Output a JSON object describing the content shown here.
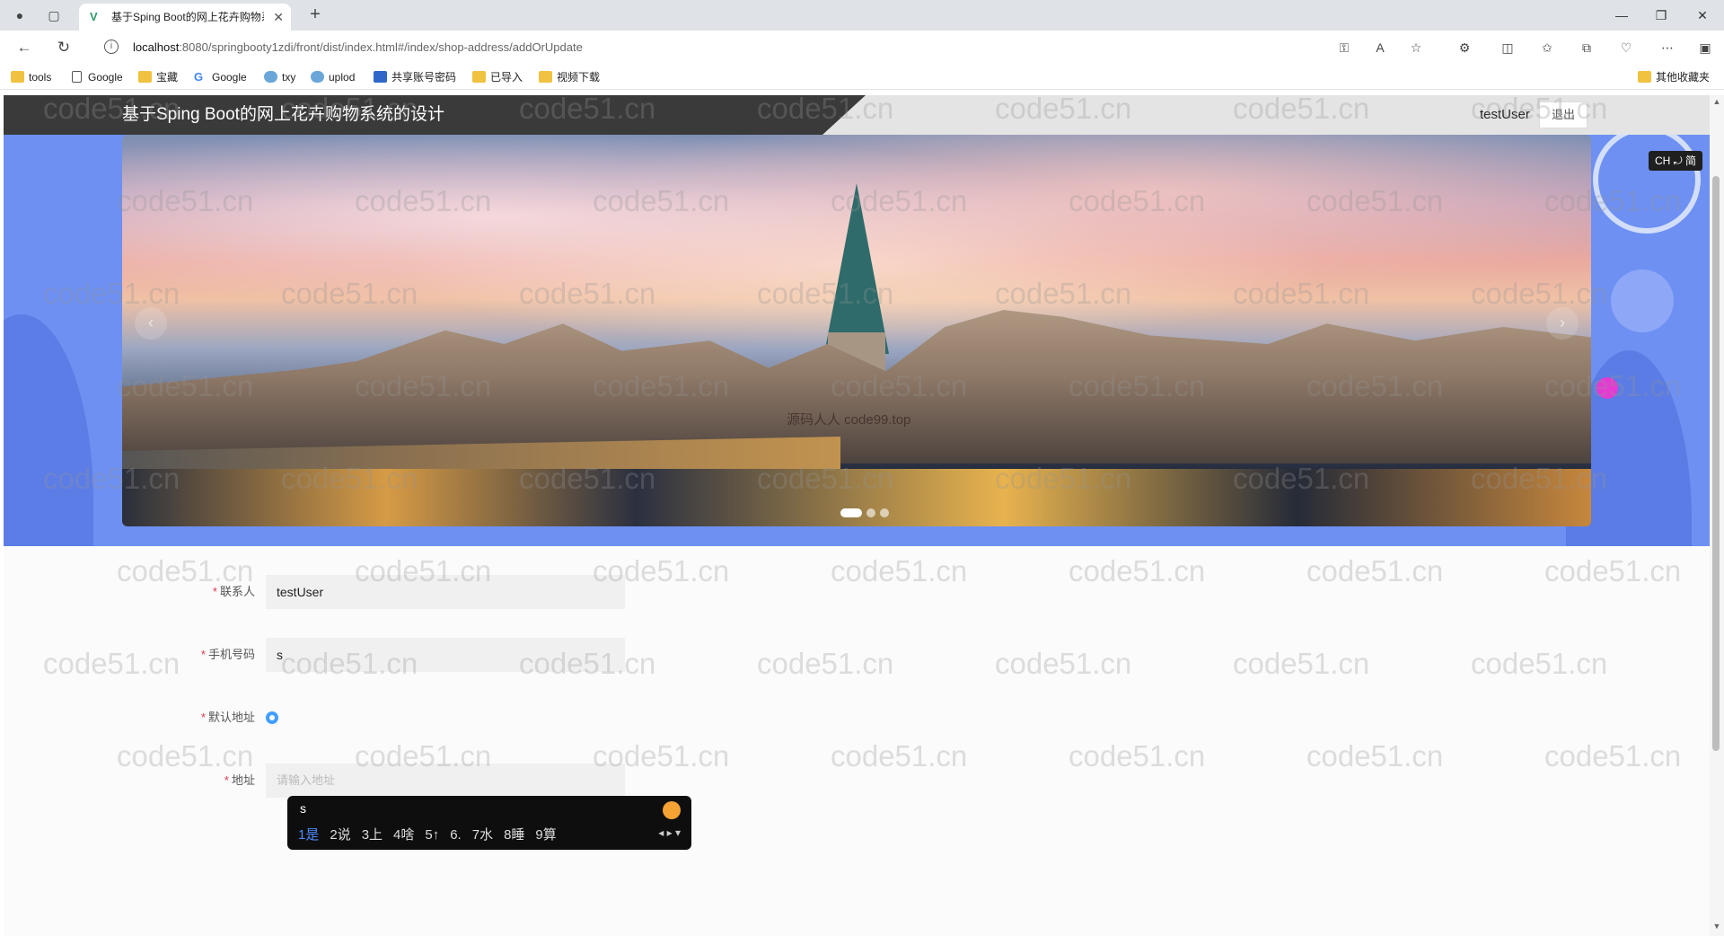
{
  "browser": {
    "tab_title": "基于Sping Boot的网上花卉购物系统",
    "new_tab": "+",
    "url_host": "localhost",
    "url_path": ":8080/springbooty1zdi/front/dist/index.html#/index/shop-address/addOrUpdate",
    "bookmarks": [
      "tools",
      "Google",
      "宝藏",
      "Google",
      "txy",
      "uplod",
      "共享账号密码",
      "已导入",
      "视频下载"
    ],
    "other_bookmarks": "其他收藏夹"
  },
  "header": {
    "title": "基于Sping Boot的网上花卉购物系统的设计",
    "username": "testUser",
    "logout": "退出"
  },
  "carousel": {
    "image_caption": "源码人人 code99.top",
    "slides": 3,
    "active_slide": 1,
    "prev": "‹",
    "next": "›"
  },
  "lang_indicator": "CH ⤾ 简",
  "form": {
    "contact": {
      "label": "联系人",
      "value": "testUser"
    },
    "phone": {
      "label": "手机号码",
      "value": "s"
    },
    "default_address": {
      "label": "默认地址"
    },
    "address": {
      "label": "地址",
      "placeholder": "请输入地址"
    }
  },
  "ime": {
    "composition": "s",
    "candidates": [
      "1是",
      "2说",
      "3上",
      "4啥",
      "5↑",
      "6.",
      "7水",
      "8睡",
      "9算"
    ]
  },
  "watermark_text": "code51.cn",
  "colors": {
    "banner": "#6d90f2",
    "header_dark": "#3a3a3a",
    "accent": "#409eff",
    "required": "#e2354b"
  }
}
